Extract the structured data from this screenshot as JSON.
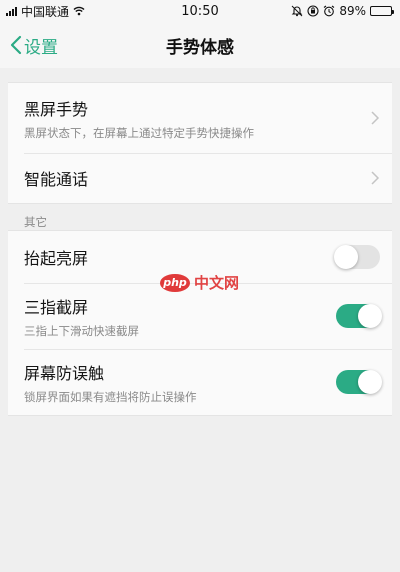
{
  "status_bar": {
    "carrier": "中国联通",
    "time": "10:50",
    "battery_percent": "89%",
    "battery_level": 0.89,
    "icons": [
      "signal-icon",
      "wifi-icon",
      "bell-icon",
      "alarm-icon",
      "battery-icon"
    ]
  },
  "nav": {
    "back_label": "设置",
    "title": "手势体感"
  },
  "group1": {
    "items": [
      {
        "title": "黑屏手势",
        "subtitle": "黑屏状态下，在屏幕上通过特定手势快捷操作"
      },
      {
        "title": "智能通话",
        "subtitle": ""
      }
    ]
  },
  "section_other": {
    "header": "其它"
  },
  "group2": {
    "items": [
      {
        "title": "抬起亮屏",
        "subtitle": "",
        "enabled": false
      },
      {
        "title": "三指截屏",
        "subtitle": "三指上下滑动快速截屏",
        "enabled": true
      },
      {
        "title": "屏幕防误触",
        "subtitle": "锁屏界面如果有遮挡将防止误操作",
        "enabled": true
      }
    ]
  },
  "watermark": {
    "logo": "php",
    "text": "中文网"
  },
  "colors": {
    "accent": "#2bab85",
    "background": "#efefef",
    "card": "#fafafa",
    "toggle_off": "#e3e3e3",
    "watermark": "#e03a3a"
  }
}
